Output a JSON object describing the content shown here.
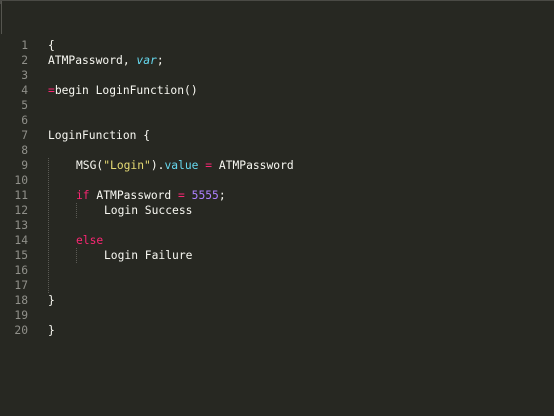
{
  "editor": {
    "lines": [
      {
        "n": "1",
        "tokens": [
          {
            "c": "plain",
            "t": "{"
          }
        ]
      },
      {
        "n": "2",
        "tokens": [
          {
            "c": "plain",
            "t": "ATMPassword, "
          },
          {
            "c": "var",
            "t": "var"
          },
          {
            "c": "plain",
            "t": ";"
          }
        ]
      },
      {
        "n": "3",
        "tokens": []
      },
      {
        "n": "4",
        "tokens": [
          {
            "c": "op",
            "t": "="
          },
          {
            "c": "plain",
            "t": "begin LoginFunction()"
          }
        ]
      },
      {
        "n": "5",
        "tokens": []
      },
      {
        "n": "6",
        "tokens": []
      },
      {
        "n": "7",
        "tokens": [
          {
            "c": "plain",
            "t": "LoginFunction {"
          }
        ]
      },
      {
        "n": "8",
        "tokens": []
      },
      {
        "n": "9",
        "indent": 4,
        "tokens": [
          {
            "c": "plain",
            "t": "MSG("
          },
          {
            "c": "str",
            "t": "\"Login\""
          },
          {
            "c": "plain",
            "t": ")."
          },
          {
            "c": "prop",
            "t": "value"
          },
          {
            "c": "plain",
            "t": " "
          },
          {
            "c": "op",
            "t": "="
          },
          {
            "c": "plain",
            "t": " ATMPassword"
          }
        ]
      },
      {
        "n": "10",
        "tokens": []
      },
      {
        "n": "11",
        "indent": 4,
        "tokens": [
          {
            "c": "kw",
            "t": "if"
          },
          {
            "c": "plain",
            "t": " ATMPassword "
          },
          {
            "c": "op",
            "t": "="
          },
          {
            "c": "plain",
            "t": " "
          },
          {
            "c": "num",
            "t": "5555"
          },
          {
            "c": "plain",
            "t": ";"
          }
        ]
      },
      {
        "n": "12",
        "indent": 8,
        "tokens": [
          {
            "c": "plain",
            "t": "Login Success"
          }
        ]
      },
      {
        "n": "13",
        "tokens": []
      },
      {
        "n": "14",
        "indent": 4,
        "tokens": [
          {
            "c": "kw",
            "t": "else"
          }
        ]
      },
      {
        "n": "15",
        "indent": 8,
        "tokens": [
          {
            "c": "plain",
            "t": "Login Failure"
          }
        ]
      },
      {
        "n": "16",
        "tokens": []
      },
      {
        "n": "17",
        "tokens": []
      },
      {
        "n": "18",
        "tokens": [
          {
            "c": "plain",
            "t": "}"
          }
        ]
      },
      {
        "n": "19",
        "tokens": []
      },
      {
        "n": "20",
        "tokens": [
          {
            "c": "plain",
            "t": "}"
          }
        ]
      }
    ]
  },
  "colors": {
    "background": "#272822",
    "foreground": "#f8f8f2",
    "gutter": "#90908a",
    "keyword": "#f92672",
    "string": "#e6db74",
    "number": "#ae81ff",
    "variable": "#66d9ef"
  }
}
